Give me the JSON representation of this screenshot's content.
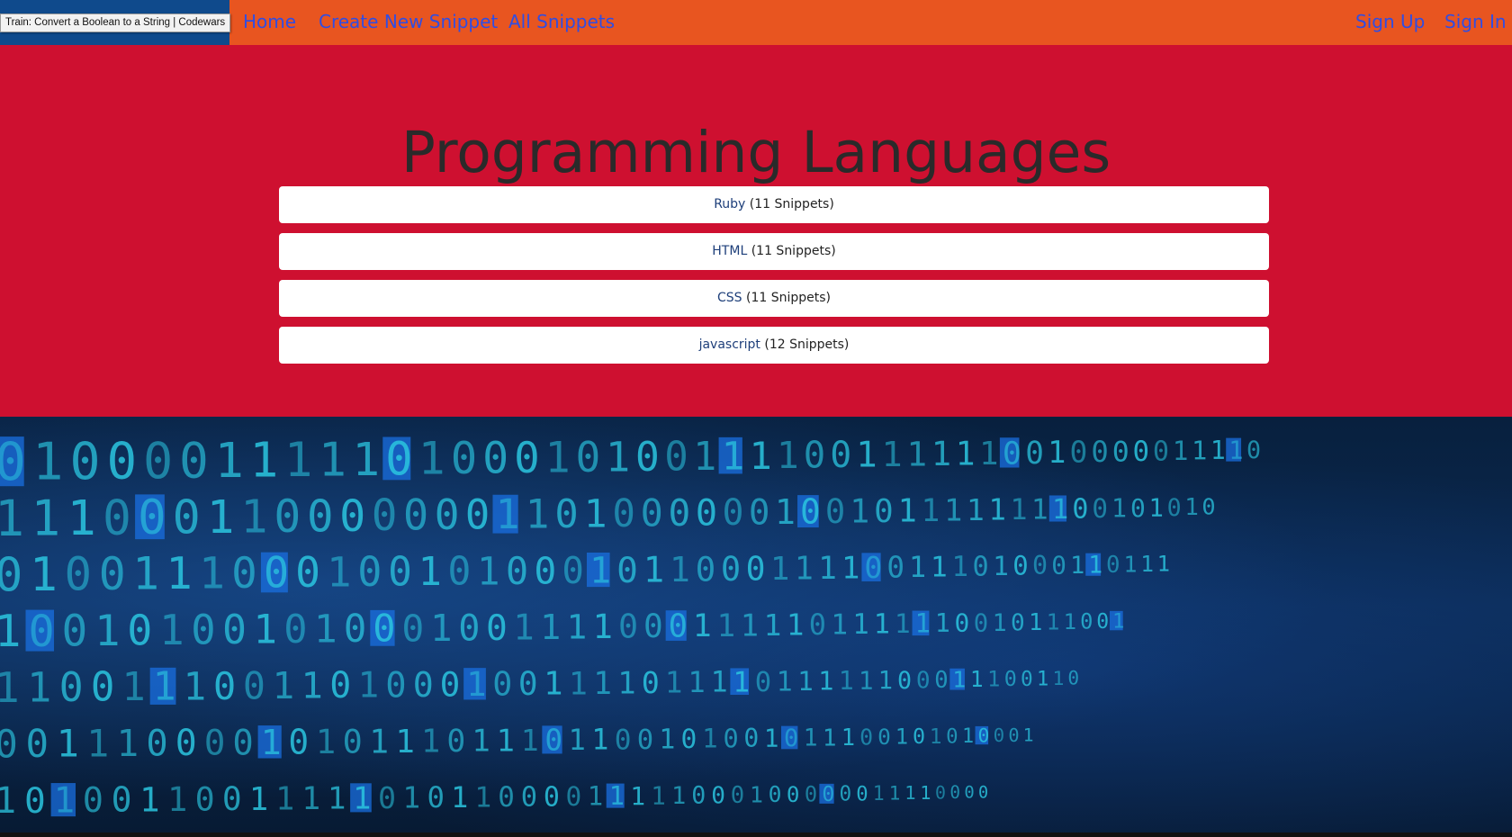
{
  "tooltip": {
    "text": "Train: Convert a Boolean to a String | Codewars"
  },
  "nav": {
    "home": "Home",
    "create": "Create New Snippet",
    "all": "All Snippets",
    "signup": "Sign Up",
    "signin": "Sign In"
  },
  "page": {
    "title": "Programming Languages"
  },
  "languages": [
    {
      "name": "Ruby",
      "count": " (11 Snippets)"
    },
    {
      "name": "HTML",
      "count": " (11 Snippets)"
    },
    {
      "name": "CSS",
      "count": " (11 Snippets)"
    },
    {
      "name": "javascript",
      "count": " (12 Snippets)"
    }
  ],
  "colors": {
    "navbar": "#e85520",
    "logo_area": "#0f4a8c",
    "nav_link": "#2f4de4",
    "hero": "#ce1030",
    "title": "#2a2a2a",
    "lang_link": "#1e3f7a",
    "digit": "#2bc6e0"
  },
  "background": {
    "rows": [
      "0100001111101000101001111001111110010000011110",
      "1110001100000001101000000100101111111100101010",
      "0100111000100101000101100011110011101000110111",
      "1001010010100010011110001111101111110010111001",
      "1100111001101000100111101111011111100011100110",
      "0011100001010111011101100101001011100101010001",
      "1010011001111101011000011111000100000011110000"
    ]
  }
}
